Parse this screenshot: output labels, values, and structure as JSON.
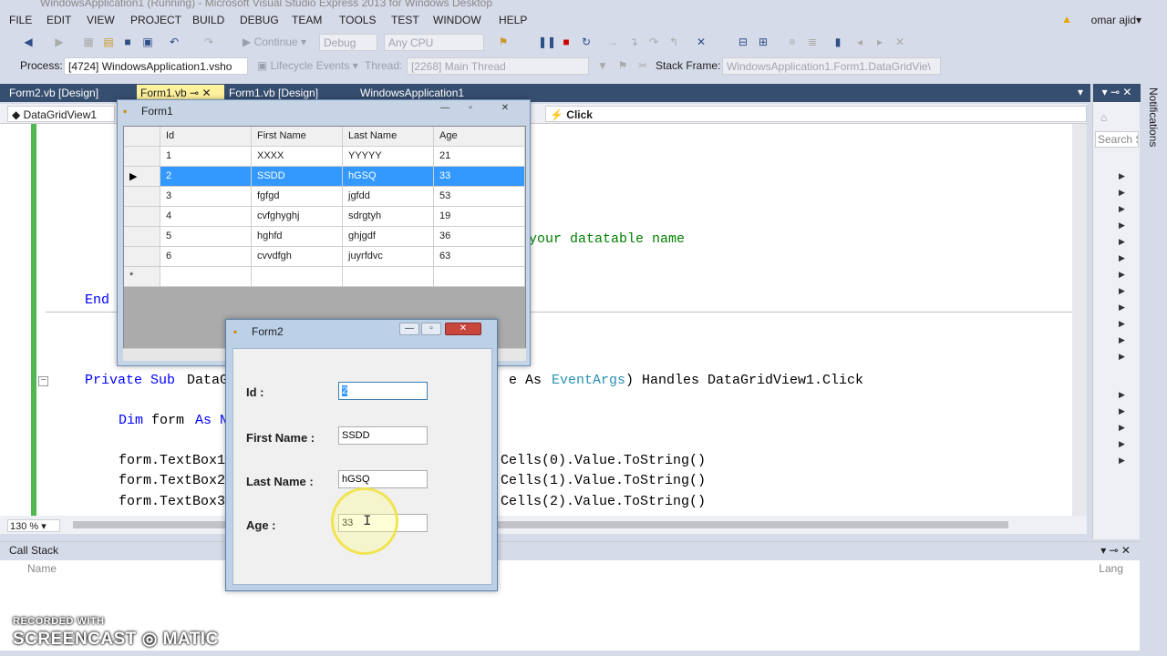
{
  "title": "WindowsApplication1 (Running) - Microsoft Visual Studio Express 2013 for Windows Desktop",
  "menu": [
    "FILE",
    "EDIT",
    "VIEW",
    "PROJECT",
    "BUILD",
    "DEBUG",
    "TEAM",
    "TOOLS",
    "TEST",
    "WINDOW",
    "HELP"
  ],
  "user": "omar ajid",
  "toolbar": {
    "continue_label": "Continue",
    "config": "Debug",
    "platform": "Any CPU"
  },
  "debugbar": {
    "process_label": "Process:",
    "process_value": "[4724] WindowsApplication1.vsho",
    "lifecycle_label": "Lifecycle Events",
    "thread_label": "Thread:",
    "thread_value": "[2268] Main Thread",
    "stackframe_label": "Stack Frame:",
    "stackframe_value": "WindowsApplication1.Form1.DataGridVie\\"
  },
  "tabs": [
    "Form2.vb [Design]",
    "Form1.vb",
    "Form1.vb [Design]",
    "WindowsApplication1"
  ],
  "nav": {
    "left": "DataGridView1",
    "right": "Click"
  },
  "code": {
    "comment_tail": "your datatable name",
    "end_kw": "End",
    "sub_line": {
      "kw1": "Private Sub",
      "mid": " DataG",
      "e_as": "e As ",
      "eventargs": "EventArgs",
      "rest": ") Handles DataGridView1.Click"
    },
    "dim_line": {
      "kw": "Dim",
      "mid": " form ",
      "as": "As N"
    },
    "lines": [
      {
        "left": "form.TextBox1",
        "right": ".Cells(0).Value.ToString()"
      },
      {
        "left": "form.TextBox2",
        "right": ".Cells(1).Value.ToString()"
      },
      {
        "left": "form.TextBox3",
        "right": ".Cells(2).Value.ToString()"
      }
    ]
  },
  "zoom": "130 %",
  "callstack": {
    "title": "Call Stack",
    "col_name": "Name",
    "col_lang": "Lang"
  },
  "rightpane": {
    "search": "Search S"
  },
  "notifications": "Notifications",
  "form1": {
    "title": "Form1",
    "columns": [
      "Id",
      "First Name",
      "Last Name",
      "Age"
    ],
    "rows": [
      [
        "1",
        "XXXX",
        "YYYYY",
        "21"
      ],
      [
        "2",
        "SSDD",
        "hGSQ",
        "33"
      ],
      [
        "3",
        "fgfgd",
        "jgfdd",
        "53"
      ],
      [
        "4",
        "cvfghyghj",
        "sdrgtyh",
        "19"
      ],
      [
        "5",
        "hghfd",
        "ghjgdf",
        "36"
      ],
      [
        "6",
        "cvvdfgh",
        "juyrfdvc",
        "63"
      ]
    ],
    "new_row_marker": "*",
    "current_row_marker": "▶"
  },
  "form2": {
    "title": "Form2",
    "fields": [
      {
        "label": "Id :",
        "value": "2"
      },
      {
        "label": "First Name :",
        "value": "SSDD"
      },
      {
        "label": "Last Name :",
        "value": "hGSQ"
      },
      {
        "label": "Age :",
        "value": "33"
      }
    ]
  },
  "watermark": {
    "line1": "RECORDED WITH",
    "line2": "SCREENCAST",
    "line3": "MATIC"
  },
  "colors": {
    "selection": "#3399ff",
    "tab_active": "#fff29d",
    "tabstrip": "#364e6f"
  }
}
